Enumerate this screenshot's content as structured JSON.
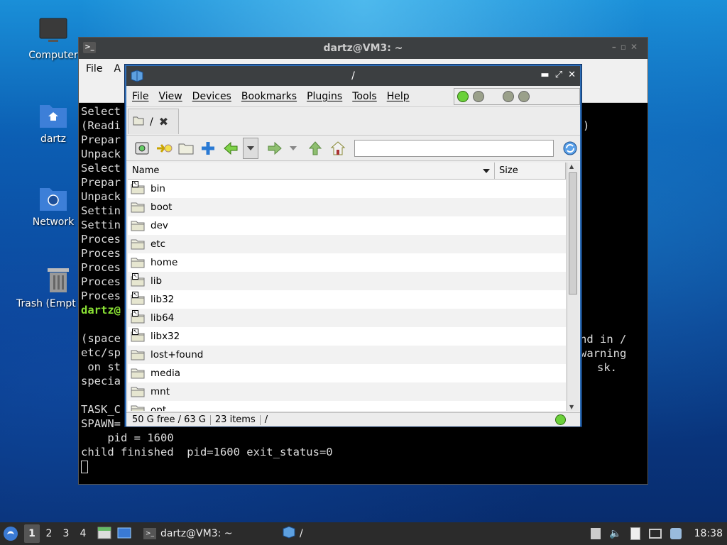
{
  "desktop": {
    "icons": [
      {
        "label": "Computer",
        "icon": "monitor-icon"
      },
      {
        "label": "dartz",
        "icon": "home-folder-icon"
      },
      {
        "label": "Network",
        "icon": "network-folder-icon"
      },
      {
        "label": "Trash (Empty)",
        "icon": "trash-icon"
      }
    ]
  },
  "terminal": {
    "title": "dartz@VM3: ~",
    "menu": [
      "File",
      "A"
    ],
    "lines": [
      "Select",
      "(Readi",
      "Prepar",
      "Unpack",
      "Select",
      "Prepar",
      "Unpack",
      "Settin",
      "Settin",
      "Proces",
      "Proces",
      "Proces",
      "Proces",
      "Proces"
    ],
    "prompt_fragment": "dartz@",
    "right_fragments": [
      ")",
      "nd in /",
      "warning",
      "sk."
    ],
    "lines2": [
      "(space",
      "etc/sp",
      " on st",
      "specia",
      "",
      "TASK_C",
      "SPAWN="
    ],
    "line_pid": "    pid = 1600",
    "line_child": "child finished  pid=1600 exit_status=0"
  },
  "filemanager": {
    "title": "/",
    "menu": [
      "File",
      "View",
      "Devices",
      "Bookmarks",
      "Plugins",
      "Tools",
      "Help"
    ],
    "tab_label": "/",
    "columns": {
      "name": "Name",
      "size": "Size"
    },
    "rows": [
      {
        "name": "bin",
        "link": true
      },
      {
        "name": "boot",
        "link": false
      },
      {
        "name": "dev",
        "link": false
      },
      {
        "name": "etc",
        "link": false
      },
      {
        "name": "home",
        "link": false
      },
      {
        "name": "lib",
        "link": true
      },
      {
        "name": "lib32",
        "link": true
      },
      {
        "name": "lib64",
        "link": true
      },
      {
        "name": "libx32",
        "link": true
      },
      {
        "name": "lost+found",
        "link": false
      },
      {
        "name": "media",
        "link": false
      },
      {
        "name": "mnt",
        "link": false
      },
      {
        "name": "opt",
        "link": false
      }
    ],
    "status": {
      "free": "50 G free / 63 G",
      "items": "23 items",
      "path": "/"
    },
    "accent_color": "#2e6db5"
  },
  "taskbar": {
    "workspaces": [
      "1",
      "2",
      "3",
      "4"
    ],
    "tasks": [
      {
        "label": "dartz@VM3: ~",
        "icon": "terminal-icon"
      },
      {
        "label": "/",
        "icon": "file-manager-icon"
      }
    ],
    "clock": "18:38"
  }
}
